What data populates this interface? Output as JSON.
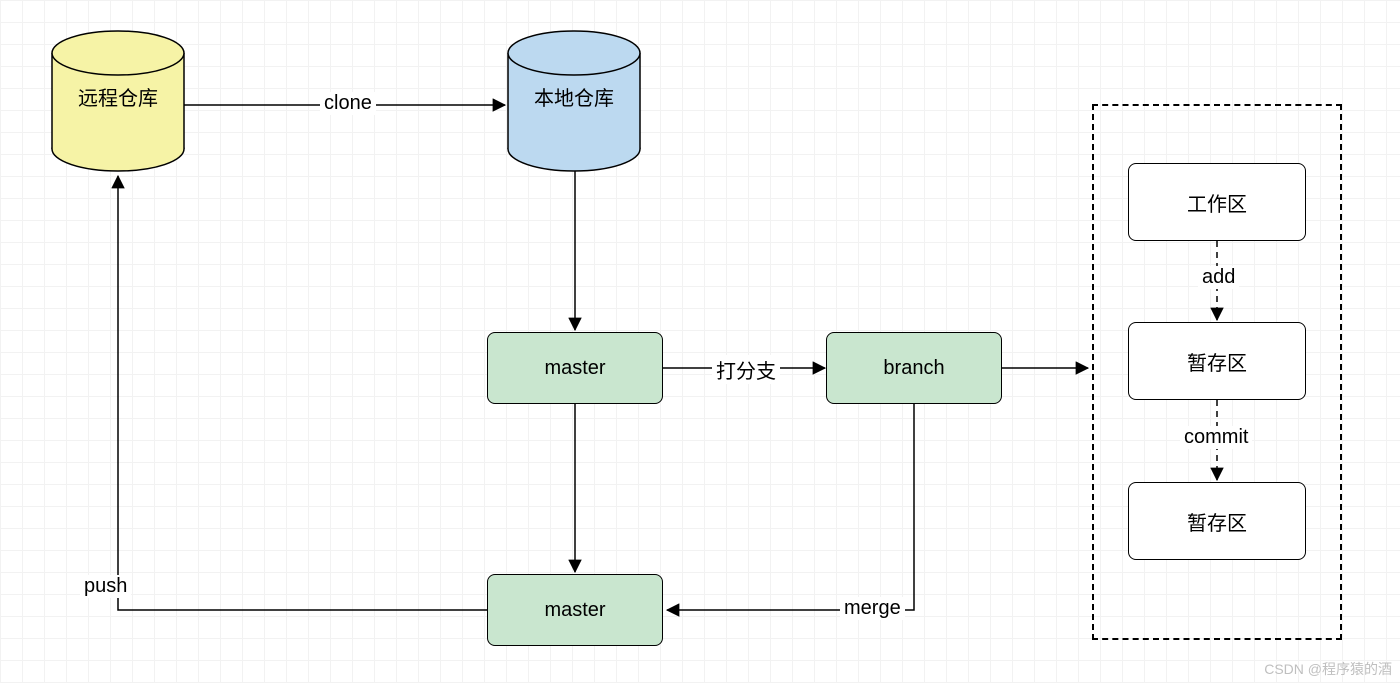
{
  "nodes": {
    "remote_repo": "远程仓库",
    "local_repo": "本地仓库",
    "master1": "master",
    "branch": "branch",
    "master2": "master",
    "work_area": "工作区",
    "stage_area": "暂存区",
    "repo_area": "暂存区"
  },
  "edges": {
    "clone": "clone",
    "branch_label": "打分支",
    "merge": "merge",
    "push": "push",
    "add": "add",
    "commit": "commit"
  },
  "watermark": "CSDN @程序猿的酒"
}
